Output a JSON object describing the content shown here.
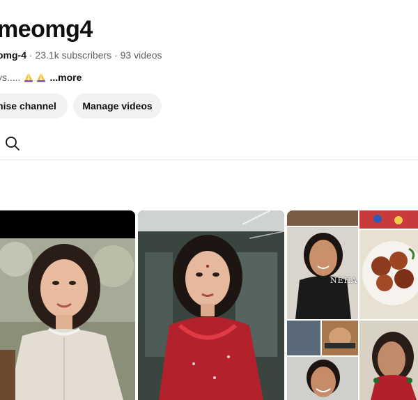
{
  "channel": {
    "name": "meomg4",
    "handle": "omg-4",
    "separator": "·",
    "subscribers": "23.1k subscribers",
    "videos": "93 videos",
    "description_snippet": "ys.....",
    "more_label": "...more"
  },
  "actions": {
    "customise_label": "mise channel",
    "manage_label": "Manage videos"
  },
  "icons": {
    "search": "search-icon",
    "pray": "folded-hands-emoji"
  },
  "thumbnails": [
    {
      "overlay_text": ""
    },
    {
      "overlay_text": ""
    },
    {
      "overlay_text": "NEHA M"
    }
  ],
  "colors": {
    "text_primary": "#0f0f0f",
    "text_secondary": "#606060",
    "button_bg": "#f2f2f2",
    "divider": "#e5e5e5"
  }
}
